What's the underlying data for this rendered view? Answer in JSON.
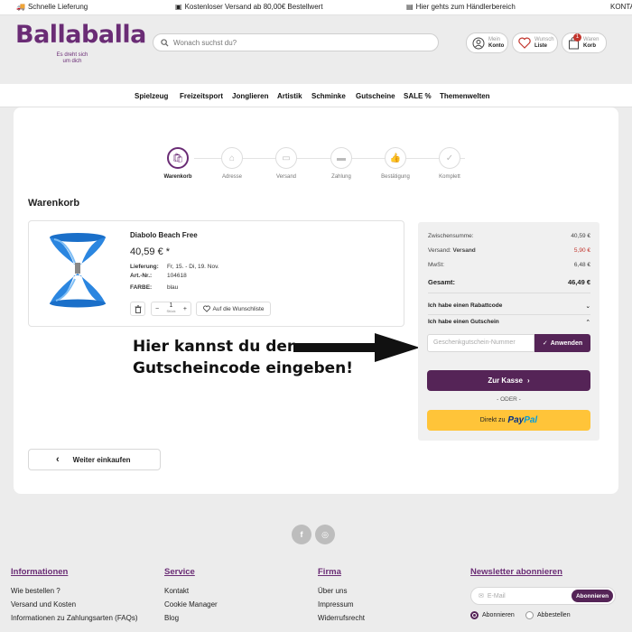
{
  "topbar": {
    "items": [
      "Schnelle Lieferung",
      "Kostenloser Versand ab 80,00€ Bestellwert",
      "Hier gehts zum Händlerbereich",
      "KONTAKT"
    ]
  },
  "header": {
    "logo": "Ballaballa",
    "logo_tagline": "Es dreht sich um dich",
    "search_placeholder": "Wonach suchst du?",
    "account": {
      "top": "Mein",
      "bottom": "Konto"
    },
    "wishlist": {
      "top": "Wunsch",
      "bottom": "Liste"
    },
    "cart": {
      "top": "Waren",
      "bottom": "Korb",
      "count": "1"
    }
  },
  "nav": {
    "items": [
      "Spielzeug",
      "Freizeitsport",
      "Jonglieren",
      "Artistik",
      "Schminke",
      "Gutscheine",
      "SALE %",
      "Themenwelten"
    ]
  },
  "steps": {
    "items": [
      "Warenkorb",
      "Adresse",
      "Versand",
      "Zahlung",
      "Bestätigung",
      "Komplett"
    ],
    "active": 0
  },
  "cart": {
    "title": "Warenkorb",
    "product": {
      "name": "Diabolo Beach Free",
      "price": "40,59 € *",
      "delivery_label": "Lieferung:",
      "delivery_value": "Fr, 15. - Di, 19. Nov.",
      "art_label": "Art.-Nr.:",
      "art_value": "104618",
      "color_label": "FARBE:",
      "color_value": "blau",
      "qty": "1",
      "qty_unit": "Stück",
      "wishlist_label": "Auf die Wunschliste"
    }
  },
  "summary": {
    "subtotal_label": "Zwischensumme:",
    "subtotal_value": "40,59 €",
    "shipping_label": "Versand:",
    "shipping_strong": "Versand",
    "shipping_value": "5,90 €",
    "tax_label": "MwSt:",
    "tax_value": "6,48 €",
    "total_label": "Gesamt:",
    "total_value": "46,49 €",
    "coupon_label": "Ich habe einen Rabattcode",
    "voucher_label": "Ich habe einen Gutschein",
    "voucher_placeholder": "Geschenkgutschein-Nummer",
    "apply_label": "Anwenden",
    "checkout_label": "Zur Kasse",
    "or_label": "- ODER -",
    "paypal_prefix": "Direkt zu",
    "paypal_pay": "Pay",
    "paypal_pal": "Pal"
  },
  "annotation": {
    "line1": "Hier kannst du den",
    "line2": "Gutscheincode eingeben!"
  },
  "continue_label": "Weiter einkaufen",
  "footer": {
    "social": [
      "f",
      "◎"
    ],
    "info": {
      "title": "Informationen",
      "links": [
        "Wie bestellen ?",
        "Versand und Kosten",
        "Informationen zu Zahlungsarten (FAQs)"
      ]
    },
    "service": {
      "title": "Service",
      "links": [
        "Kontakt",
        "Cookie Manager",
        "Blog"
      ]
    },
    "firma": {
      "title": "Firma",
      "links": [
        "Über uns",
        "Impressum",
        "Widerrufsrecht"
      ]
    },
    "newsletter": {
      "title": "Newsletter abonnieren",
      "placeholder": "E-Mail",
      "button": "Abonnieren",
      "subscribe": "Abonnieren",
      "unsubscribe": "Abbestellen"
    }
  },
  "colors": {
    "brand": "#6a2c75",
    "button": "#552457",
    "price_red": "#c2362e",
    "paypal": "#ffc439"
  }
}
